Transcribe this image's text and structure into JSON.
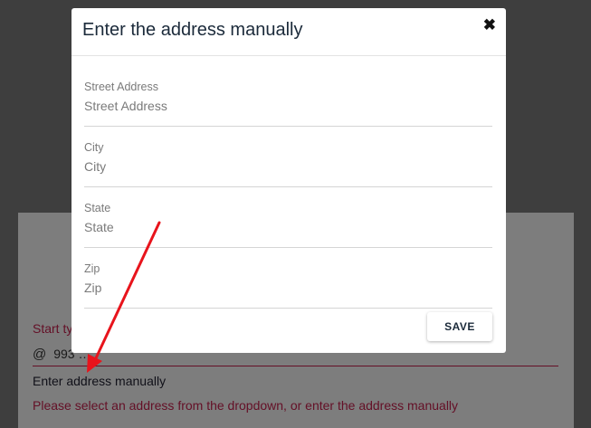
{
  "background": {
    "input_label": "Start ty",
    "input_icon": "at-sign-icon",
    "input_value": "993 …",
    "manual_link": "Enter address manually",
    "error": "Please select an address from the dropdown, or enter the address manually"
  },
  "modal": {
    "title": "Enter the address manually",
    "close_label": "✖",
    "fields": [
      {
        "label": "Street Address",
        "placeholder": "Street Address"
      },
      {
        "label": "City",
        "placeholder": "City"
      },
      {
        "label": "State",
        "placeholder": "State"
      },
      {
        "label": "Zip",
        "placeholder": "Zip"
      }
    ],
    "save_label": "SAVE"
  },
  "colors": {
    "accent_error": "#c8214e",
    "annotation_arrow": "#e8141c"
  }
}
